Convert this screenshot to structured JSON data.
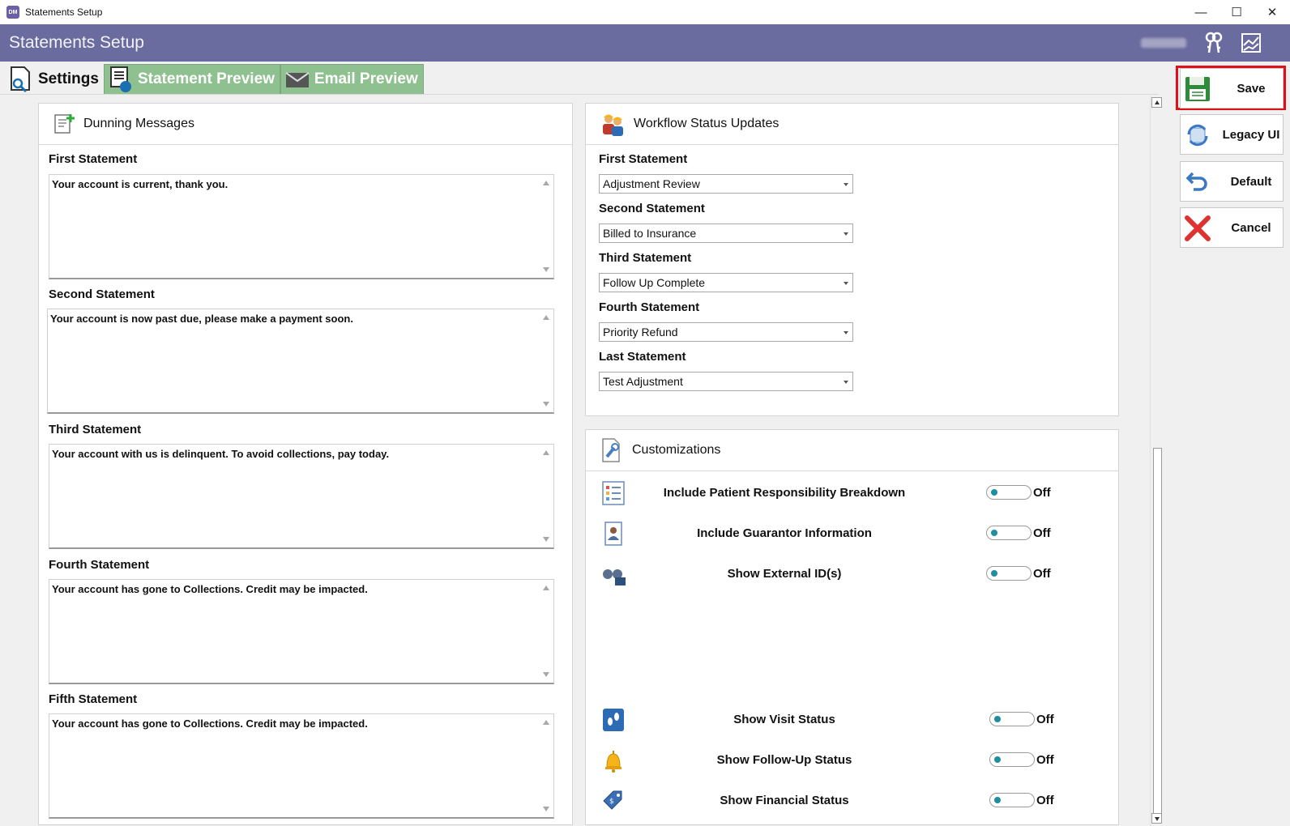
{
  "window": {
    "title": "Statements Setup"
  },
  "app": {
    "title": "Statements Setup"
  },
  "tabs": [
    {
      "label": "Settings",
      "active": true
    },
    {
      "label": "Statement Preview",
      "active": false
    },
    {
      "label": "Email Preview",
      "active": false
    }
  ],
  "dunning": {
    "title": "Dunning Messages",
    "items": [
      {
        "label": "First Statement",
        "text": "Your account is current, thank you."
      },
      {
        "label": "Second Statement",
        "text": "Your account is now past due, please make a payment soon."
      },
      {
        "label": "Third Statement",
        "text": "Your account with us is delinquent. To avoid collections, pay today."
      },
      {
        "label": "Fourth Statement",
        "text": "Your account has gone to Collections. Credit may be impacted."
      },
      {
        "label": "Fifth Statement",
        "text": "Your account has gone to Collections. Credit may be impacted."
      }
    ]
  },
  "workflow": {
    "title": "Workflow Status Updates",
    "items": [
      {
        "label": "First Statement",
        "value": "Adjustment Review"
      },
      {
        "label": "Second Statement",
        "value": "Billed to Insurance"
      },
      {
        "label": "Third Statement",
        "value": "Follow Up Complete"
      },
      {
        "label": "Fourth Statement",
        "value": "Priority Refund"
      },
      {
        "label": "Last Statement",
        "value": "Test Adjustment"
      }
    ]
  },
  "customizations": {
    "title": "Customizations",
    "items": [
      {
        "label": "Include Patient Responsibility Breakdown",
        "state": "Off",
        "icon": "list-icon"
      },
      {
        "label": "Include Guarantor Information",
        "state": "Off",
        "icon": "id-card-icon"
      },
      {
        "label": "Show External ID(s)",
        "state": "Off",
        "icon": "binoculars-icon"
      },
      {
        "label": "Show Visit Status",
        "state": "Off",
        "icon": "footprints-icon"
      },
      {
        "label": "Show Follow-Up Status",
        "state": "Off",
        "icon": "bell-icon"
      },
      {
        "label": "Show Financial Status",
        "state": "Off",
        "icon": "price-tag-icon"
      }
    ]
  },
  "actions": {
    "save": "Save",
    "legacy": "Legacy UI",
    "default": "Default",
    "cancel": "Cancel"
  },
  "colors": {
    "header": "#6a6b9e",
    "tab_inactive": "#8fc08f",
    "toggle_knob": "#1d8fa0",
    "highlight": "#e0101a"
  }
}
